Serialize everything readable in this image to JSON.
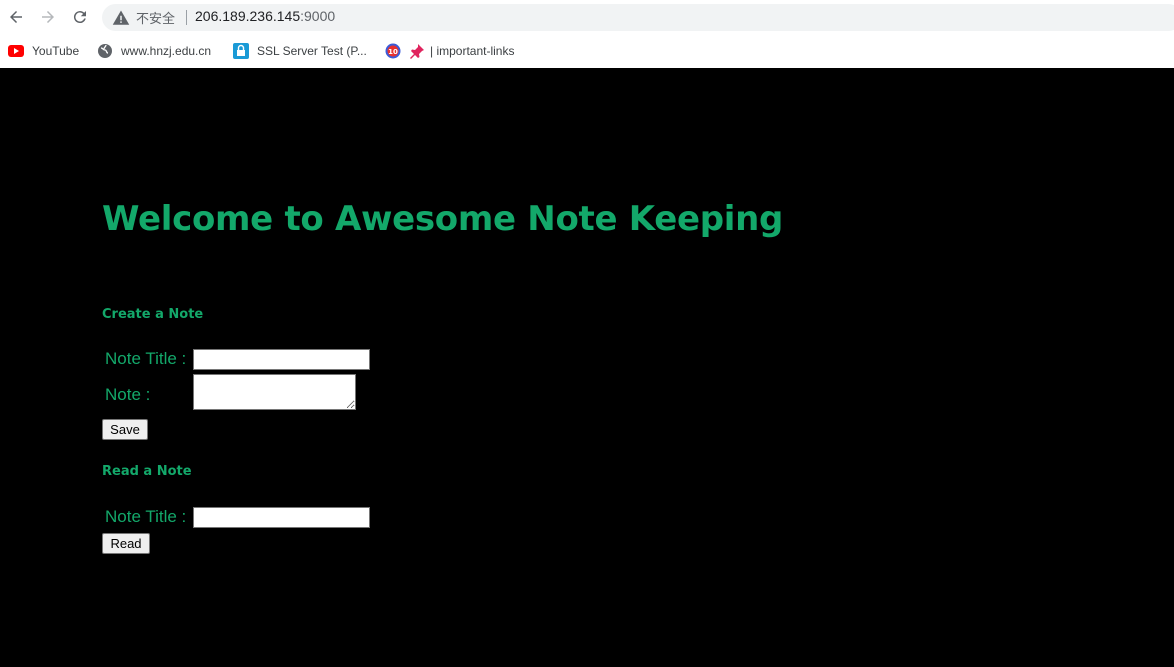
{
  "browser": {
    "insecure_label": "不安全",
    "url_host": "206.189.236.145",
    "url_port": ":9000",
    "bookmarks": [
      {
        "label": "YouTube",
        "icon": "youtube-icon"
      },
      {
        "label": "www.hnzj.edu.cn",
        "icon": "globe-icon"
      },
      {
        "label": "SSL Server Test (P...",
        "icon": "lock-icon"
      },
      {
        "label": "",
        "icon": "timer-icon"
      },
      {
        "label": "| important-links",
        "icon": "pin-icon"
      }
    ]
  },
  "page": {
    "title": "Welcome to Awesome Note Keeping",
    "create_heading": "Create a Note",
    "note_title_label": "Note Title :",
    "note_label": "Note :",
    "save_button": "Save",
    "read_heading": "Read a Note",
    "read_title_label": "Note Title :",
    "read_button": "Read"
  },
  "colors": {
    "accent": "#13a86a",
    "background": "#000000"
  }
}
